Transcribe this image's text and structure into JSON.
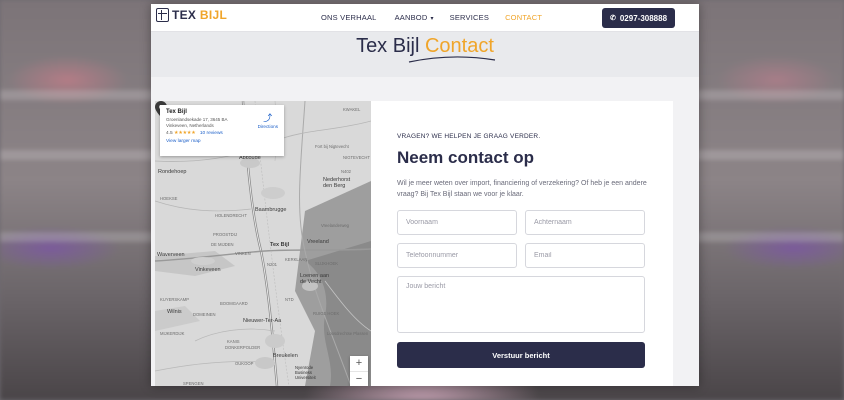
{
  "brand": {
    "logo_word1": "TEX",
    "logo_word2": "BIJL",
    "primary_color": "#2b2d4a",
    "accent_color": "#f0a52a"
  },
  "nav": {
    "items": [
      {
        "label": "ONS VERHAAL"
      },
      {
        "label": "AANBOD",
        "has_dropdown": true
      },
      {
        "label": "SERVICES"
      },
      {
        "label": "CONTACT",
        "active": true
      }
    ],
    "phone": "0297-308888"
  },
  "hero": {
    "title_main": "Tex Bijl",
    "title_accent": "Contact"
  },
  "map": {
    "card": {
      "title": "Tex Bijl",
      "address": "Groenlandsekade 17, 3645 BA Vinkeveen, Netherlands",
      "rating": "4.5",
      "stars": "★★★★★",
      "reviews": "10 reviews",
      "larger_map": "View larger map",
      "directions": "Directions"
    },
    "labels": {
      "abcoude": "Abcoude",
      "baambrugge": "Baambrugge",
      "vinkeveen": "Vinkeveen",
      "waverveen": "Waverveen",
      "vreeland": "Vreeland",
      "loenen": "Loenen aan de Vecht",
      "nieuwer": "Nieuwer-Ter-Aa",
      "breukelen": "Breukelen",
      "nederhorst": "Nederhorst den Berg",
      "fort": "Fort bij Nigtevecht",
      "wilnis": "Wilnis",
      "nyenrode": "Nyenrode Business Universiteit",
      "pin": "Tex Bijl",
      "rondehoep": "Rondehoep",
      "hoekse": "HOEKSE",
      "holendrecht": "HOLENDRECHT",
      "proostdij": "PROOSTDIJ",
      "demijden": "DE MIJDEN",
      "kerklaan": "KERKLAAN",
      "boomgaard": "BOOMGAARD",
      "domeinen": "DOMEINEN",
      "spengen": "SPENGEN",
      "n201": "N201",
      "kuyerskamp": "KUYERSKAMP",
      "mijkerdijk": "MIJKERDIJK",
      "donkerpolder": "DONKERPOLDER",
      "kanis": "KANIS",
      "vinken": "VINKEN",
      "oukoop": "OUKOOP",
      "vreelanderweg": "Vreelanderweg",
      "ruigehoek": "RUIGE HOEK",
      "slijkhoek": "SLIJKHOEK",
      "ntd": "NTD",
      "loosdrechtse": "Loosdrechtse Plassen",
      "nigtevecht": "NIGTEVECHT",
      "n402": "N402",
      "kwakel": "KWAKEL"
    },
    "zoom_in": "+",
    "zoom_out": "−"
  },
  "form": {
    "eyebrow": "VRAGEN? WE HELPEN JE GRAAG VERDER.",
    "title": "Neem contact op",
    "intro": "Wil je meer weten over import, financiering of verzekering? Of heb je een andere vraag? Bij Tex Bijl staan we voor je klaar.",
    "firstname_placeholder": "Voornaam",
    "lastname_placeholder": "Achternaam",
    "phone_placeholder": "Telefoonnummer",
    "email_placeholder": "Email",
    "message_placeholder": "Jouw bericht",
    "submit_label": "Verstuur bericht"
  }
}
